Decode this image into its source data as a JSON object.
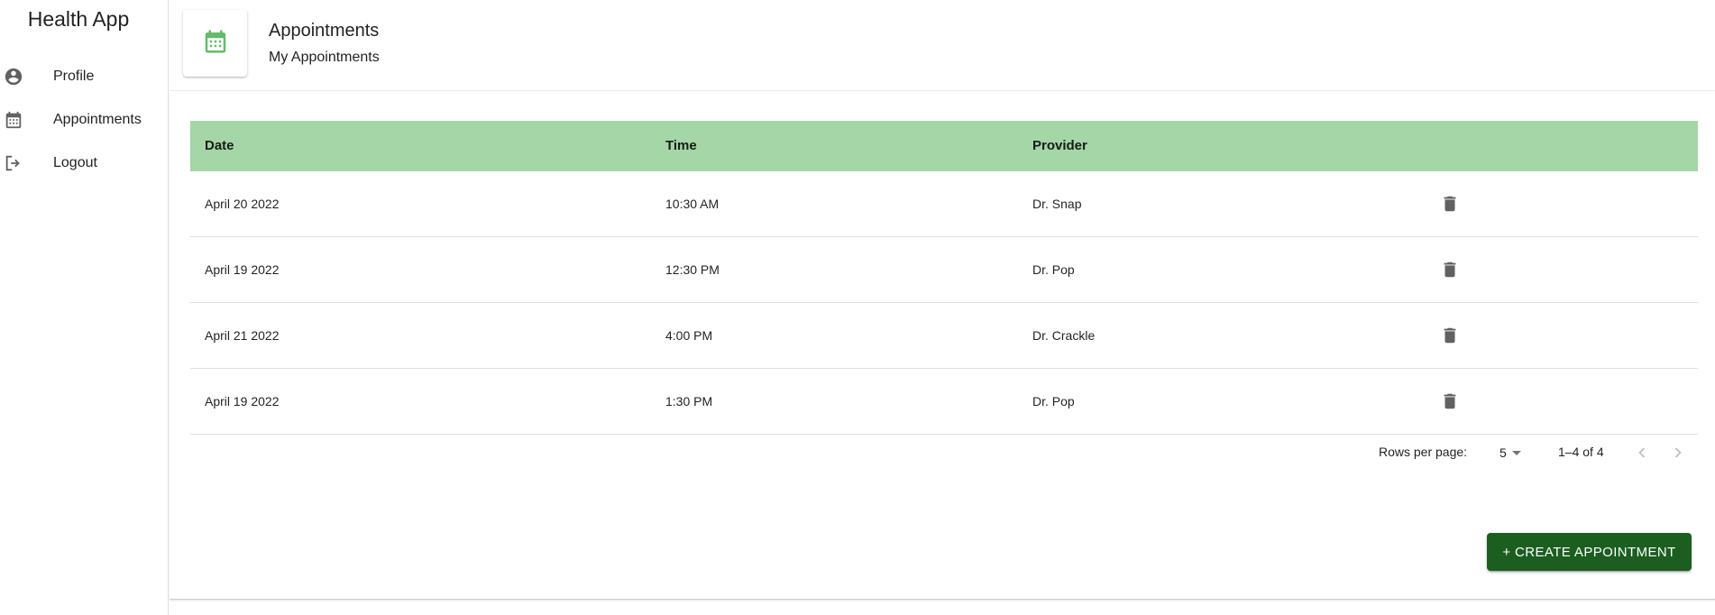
{
  "app": {
    "title": "Health App"
  },
  "sidebar": {
    "items": [
      {
        "label": "Profile",
        "icon": "account-circle-icon"
      },
      {
        "label": "Appointments",
        "icon": "calendar-icon"
      },
      {
        "label": "Logout",
        "icon": "logout-icon"
      }
    ]
  },
  "header": {
    "title": "Appointments",
    "subtitle": "My Appointments",
    "icon": "calendar-icon"
  },
  "table": {
    "columns": [
      "Date",
      "Time",
      "Provider"
    ],
    "rows": [
      {
        "date": "April 20 2022",
        "time": "10:30 AM",
        "provider": "Dr. Snap"
      },
      {
        "date": "April 19 2022",
        "time": "12:30 PM",
        "provider": "Dr. Pop"
      },
      {
        "date": "April 21 2022",
        "time": "4:00 PM",
        "provider": "Dr. Crackle"
      },
      {
        "date": "April 19 2022",
        "time": "1:30 PM",
        "provider": "Dr. Pop"
      }
    ]
  },
  "pagination": {
    "rows_per_page_label": "Rows per page:",
    "rows_per_page_value": "5",
    "range": "1–4 of 4"
  },
  "actions": {
    "create_label": "+ CREATE APPOINTMENT"
  },
  "colors": {
    "header_row": "#a5d6a7",
    "accent_dark": "#1b5e20",
    "icon_green": "#66bb6a",
    "icon_gray": "#616161"
  }
}
